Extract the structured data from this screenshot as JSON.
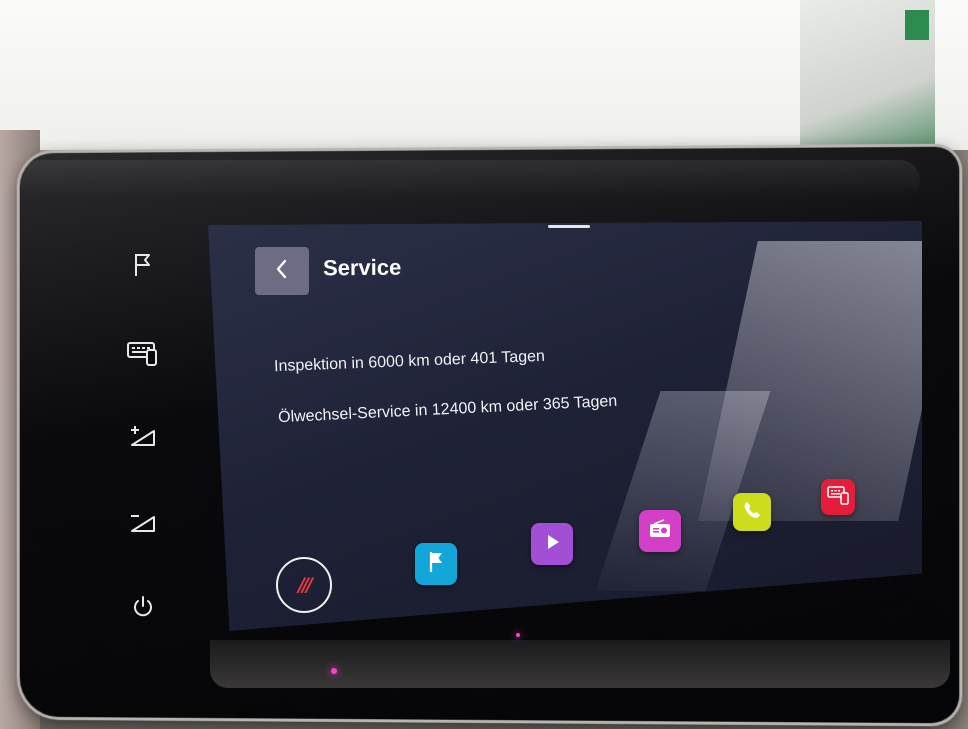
{
  "side_controls": [
    {
      "icon": "flag-icon"
    },
    {
      "icon": "display-mode-icon"
    },
    {
      "icon": "volume-up-icon"
    },
    {
      "icon": "volume-down-icon"
    },
    {
      "icon": "power-icon"
    }
  ],
  "header": {
    "title": "Service",
    "back_icon": "chevron-left-icon"
  },
  "service": {
    "inspection": "Inspektion in 6000 km oder 401 Tagen",
    "oil_change": "Ölwechsel-Service in 12400 km oder 365 Tagen"
  },
  "dock": {
    "home_glyph": "///",
    "apps": [
      {
        "name": "navigation",
        "icon": "flag-icon",
        "color": "#12a7d8"
      },
      {
        "name": "media",
        "icon": "play-icon",
        "color": "#a24fd6"
      },
      {
        "name": "radio",
        "icon": "radio-icon",
        "color": "#d43fc8"
      },
      {
        "name": "phone",
        "icon": "phone-icon",
        "color": "#cddc1b"
      },
      {
        "name": "vehicle-settings",
        "icon": "vehicle-settings-icon",
        "color": "#e41d3a"
      }
    ]
  },
  "colors": {
    "screen_bg": "#1f2237",
    "back_button": "#6e6c84",
    "home_accent": "#e53a3a"
  }
}
